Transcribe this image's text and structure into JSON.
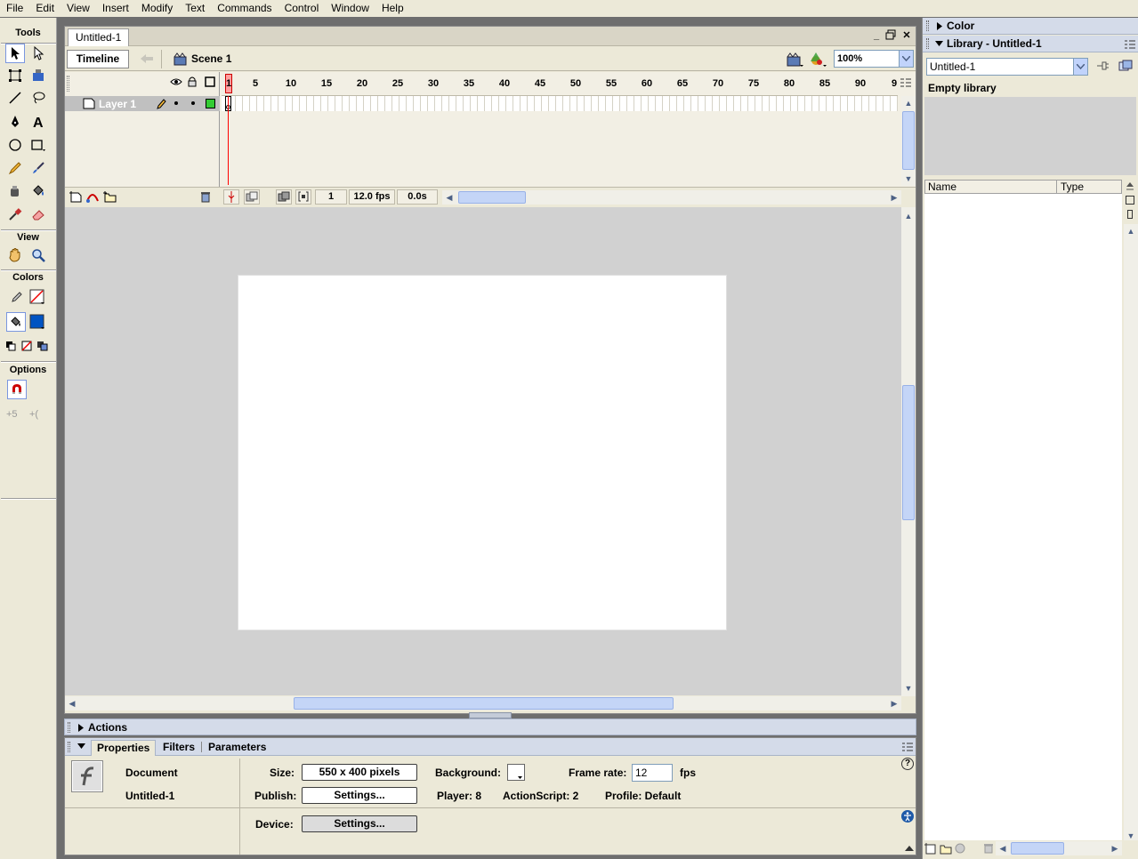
{
  "menu": [
    "File",
    "Edit",
    "View",
    "Insert",
    "Modify",
    "Text",
    "Commands",
    "Control",
    "Window",
    "Help"
  ],
  "tools": {
    "title": "Tools",
    "view_label": "View",
    "colors_label": "Colors",
    "options_label": "Options"
  },
  "document": {
    "tab": "Untitled-1",
    "timeline_button": "Timeline",
    "scene": "Scene 1",
    "zoom": "100%"
  },
  "timeline": {
    "layer_name": "Layer 1",
    "frame_numbers": [
      "1",
      "5",
      "10",
      "15",
      "20",
      "25",
      "30",
      "35",
      "40",
      "45",
      "50",
      "55",
      "60",
      "65",
      "70",
      "75",
      "80",
      "85",
      "90",
      "9"
    ],
    "current_frame": "1",
    "fps": "12.0 fps",
    "elapsed": "0.0s"
  },
  "panels": {
    "actions": "Actions",
    "properties_tabs": [
      "Properties",
      "Filters",
      "Parameters"
    ]
  },
  "properties": {
    "doc_type": "Document",
    "doc_name": "Untitled-1",
    "size_label": "Size:",
    "size_value": "550 x 400 pixels",
    "background_label": "Background:",
    "frame_rate_label": "Frame rate:",
    "frame_rate_value": "12",
    "fps_label": "fps",
    "publish_label": "Publish:",
    "settings_button": "Settings...",
    "player": "Player: 8",
    "actionscript": "ActionScript:  2",
    "profile": "Profile:  Default",
    "device_label": "Device:",
    "device_settings_button": "Settings...",
    "help_icon": "?"
  },
  "right_panel": {
    "color_title": "Color",
    "library_title": "Library - Untitled-1",
    "library_select": "Untitled-1",
    "empty": "Empty library",
    "col_name": "Name",
    "col_type": "Type"
  },
  "colors": {
    "chrome": "#ece9d8",
    "panel_header": "#d4dbe9",
    "stage_bg": "#d1d1d1",
    "stage": "#ffffff",
    "fill": "#0053c2",
    "playhead": "#ff0000"
  }
}
